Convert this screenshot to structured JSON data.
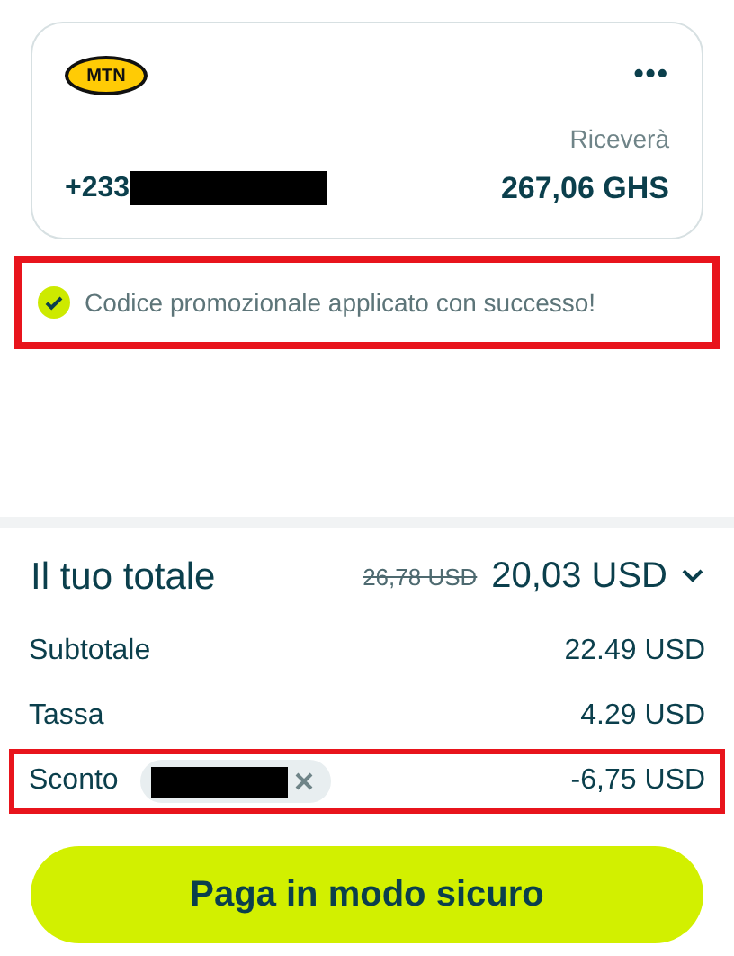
{
  "recipient_card": {
    "carrier_logo": "MTN",
    "menu": "•••",
    "phone_prefix": "+233",
    "receive_label": "Riceverà",
    "receive_amount": "267,06 GHS"
  },
  "promo_banner": {
    "message": "Codice promozionale applicato con successo!",
    "highlighted": true
  },
  "total": {
    "label": "Il tuo totale",
    "original": "26,78 USD",
    "amount": "20,03 USD",
    "expanded": false
  },
  "summary_rows": [
    {
      "kind": "plain",
      "label": "Subtotale",
      "value": "22.49 USD",
      "highlighted": false
    },
    {
      "kind": "plain",
      "label": "Tassa",
      "value": "4.29 USD",
      "highlighted": false
    },
    {
      "kind": "discount",
      "label": "Sconto",
      "value": "-6,75 USD",
      "highlighted": true
    }
  ],
  "pay_button": {
    "label": "Paga in modo sicuro"
  }
}
